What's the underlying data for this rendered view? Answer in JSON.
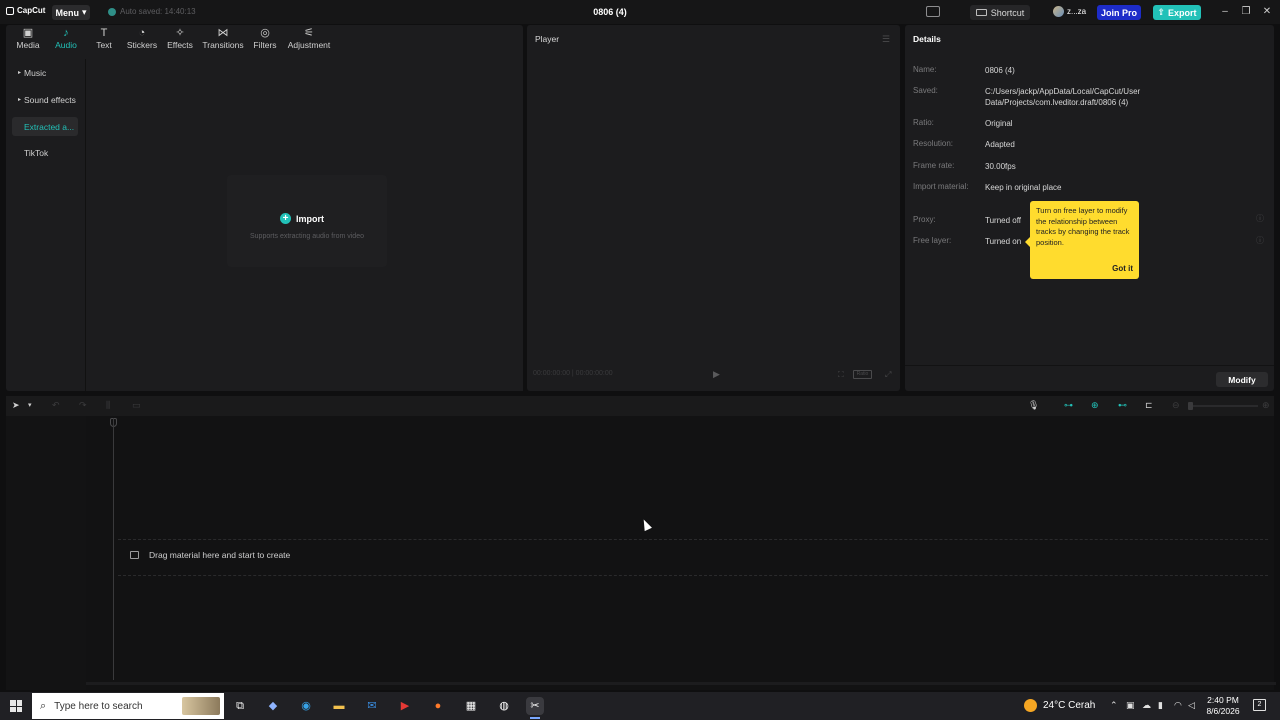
{
  "app": {
    "logo_text": "CapCut",
    "menu_label": "Menu",
    "autosave_text": "Auto saved: 14:40:13",
    "project_title": "0806 (4)",
    "shortcut_label": "Shortcut",
    "user_name": "z...za",
    "join_pro_label": "Join Pro",
    "export_label": "Export"
  },
  "toolbar": {
    "tabs": [
      {
        "label": "Media",
        "icon": "media-icon"
      },
      {
        "label": "Audio",
        "icon": "audio-icon"
      },
      {
        "label": "Text",
        "icon": "text-icon"
      },
      {
        "label": "Stickers",
        "icon": "stickers-icon"
      },
      {
        "label": "Effects",
        "icon": "effects-icon"
      },
      {
        "label": "Transitions",
        "icon": "transitions-icon"
      },
      {
        "label": "Filters",
        "icon": "filters-icon"
      },
      {
        "label": "Adjustment",
        "icon": "adjustment-icon"
      }
    ],
    "active": "Audio"
  },
  "sidebar": {
    "items": [
      {
        "label": "Music"
      },
      {
        "label": "Sound effects"
      },
      {
        "label": "Extracted a..."
      },
      {
        "label": "TikTok"
      }
    ]
  },
  "import": {
    "label": "Import",
    "subtitle": "Supports extracting audio from video"
  },
  "player": {
    "title": "Player",
    "timecode": "00:00:00:00 | 00:00:00:00",
    "ratio_label": "Ratio"
  },
  "details": {
    "title": "Details",
    "rows": [
      {
        "label": "Name:",
        "value": "0806 (4)"
      },
      {
        "label": "Saved:",
        "value": "C:/Users/jackp/AppData/Local/CapCut/User Data/Projects/com.lveditor.draft/0806 (4)"
      },
      {
        "label": "Ratio:",
        "value": "Original"
      },
      {
        "label": "Resolution:",
        "value": "Adapted"
      },
      {
        "label": "Frame rate:",
        "value": "30.00fps"
      },
      {
        "label": "Import material:",
        "value": "Keep in original place"
      },
      {
        "label": "Proxy:",
        "value": "Turned off"
      },
      {
        "label": "Free layer:",
        "value": "Turned on"
      }
    ],
    "tooltip_text": "Turn on free layer to modify the relationship between tracks by changing the track position.",
    "tooltip_button": "Got it",
    "modify_label": "Modify"
  },
  "timeline": {
    "playhead_label": "0",
    "drop_hint": "Drag material here and start to create"
  },
  "taskbar": {
    "search_placeholder": "Type here to search",
    "weather": "24°C  Cerah",
    "time": "2:40 PM",
    "date": "8/6/2026",
    "notification_count": "2"
  },
  "colors": {
    "accent": "#22c1b8",
    "join_pro": "#1d2cc9",
    "tooltip": "#ffdc2e",
    "panel": "#1c1c1e",
    "background": "#0f0f10"
  }
}
